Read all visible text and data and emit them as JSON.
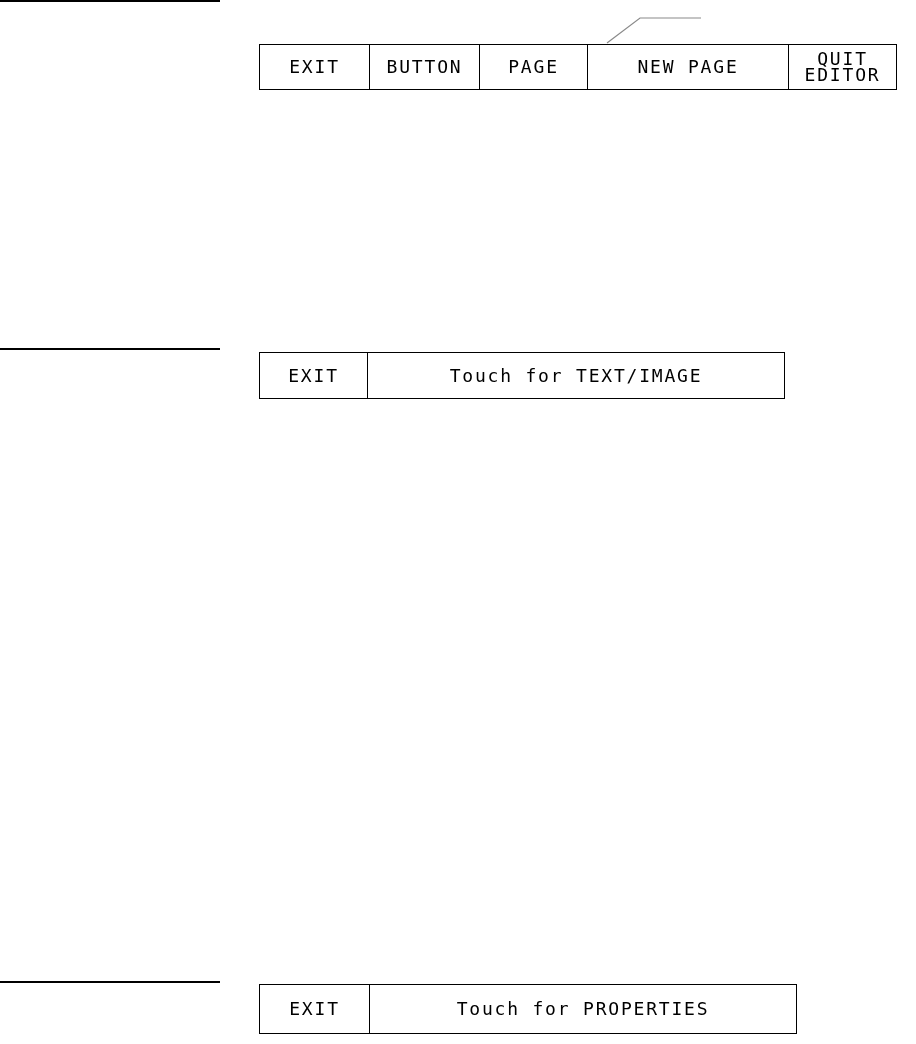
{
  "panels": [
    {
      "buttons": [
        "EXIT",
        "BUTTON",
        "PAGE",
        "NEW PAGE",
        "QUIT EDITOR"
      ]
    },
    {
      "buttons": [
        "EXIT",
        "Touch for TEXT/IMAGE"
      ]
    },
    {
      "buttons": [
        "EXIT",
        "Touch for PROPERTIES"
      ]
    }
  ]
}
